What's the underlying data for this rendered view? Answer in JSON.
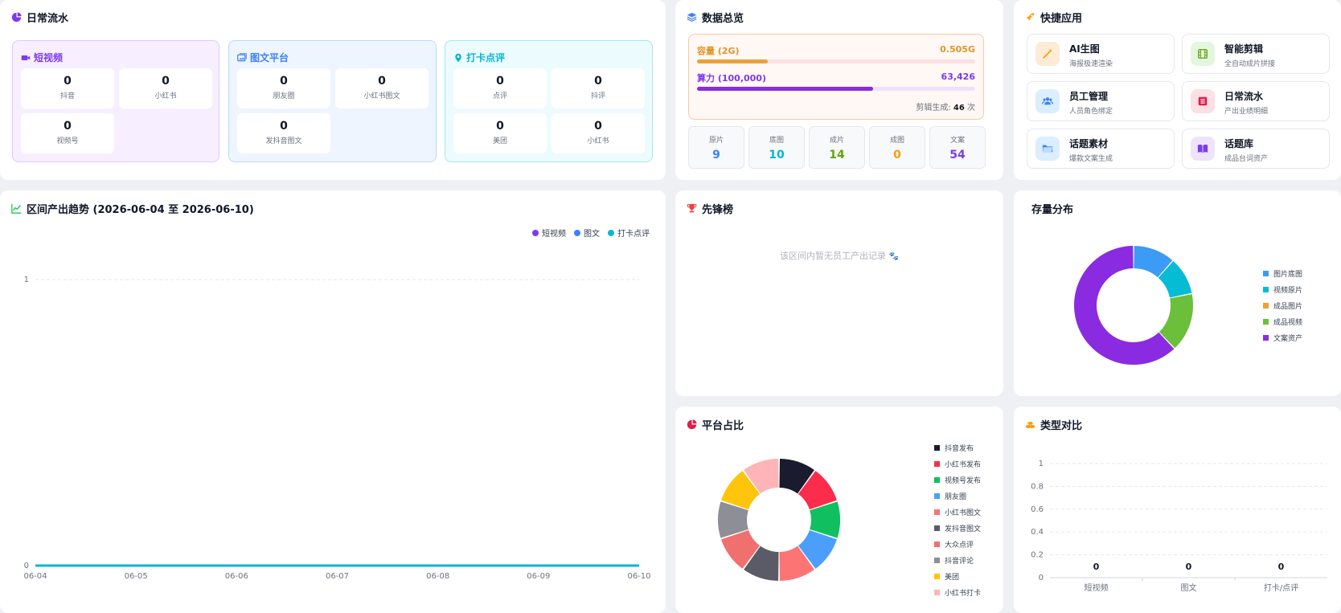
{
  "daily": {
    "title": "日常流水",
    "groups": [
      {
        "title": "短视频",
        "color": "#7c3aed",
        "items": [
          {
            "value": "0",
            "label": "抖音"
          },
          {
            "value": "0",
            "label": "小红书"
          },
          {
            "value": "0",
            "label": "视频号"
          }
        ]
      },
      {
        "title": "图文平台",
        "color": "#3b82f6",
        "items": [
          {
            "value": "0",
            "label": "朋友圈"
          },
          {
            "value": "0",
            "label": "小红书图文"
          },
          {
            "value": "0",
            "label": "发抖音图文"
          }
        ]
      },
      {
        "title": "打卡点评",
        "color": "#06b6d4",
        "items": [
          {
            "value": "0",
            "label": "点评"
          },
          {
            "value": "0",
            "label": "抖评"
          },
          {
            "value": "0",
            "label": "美团"
          },
          {
            "value": "0",
            "label": "小红书"
          }
        ]
      }
    ]
  },
  "overview": {
    "title": "数据总览",
    "capacity": {
      "label": "容量 (2G)",
      "value": "0.505G",
      "progress": 0.253
    },
    "compute": {
      "label": "算力 (100,000)",
      "value": "63,426",
      "progress": 0.634
    },
    "gen_prefix": "剪辑生成:",
    "gen_count": "46",
    "gen_suffix": "次",
    "stats": [
      {
        "label": "原片",
        "value": "9",
        "color": "#3b82f6"
      },
      {
        "label": "底图",
        "value": "10",
        "color": "#06b6d4"
      },
      {
        "label": "成片",
        "value": "14",
        "color": "#65a30d"
      },
      {
        "label": "成图",
        "value": "0",
        "color": "#f59e0b"
      },
      {
        "label": "文案",
        "value": "54",
        "color": "#7c3aed"
      }
    ]
  },
  "quick": {
    "title": "快捷应用",
    "apps": [
      {
        "title": "AI生图",
        "sub": "海报极速渲染",
        "icon": "magic-wand-icon",
        "bg": "#fdebd6",
        "fg": "#f59e0b"
      },
      {
        "title": "智能剪辑",
        "sub": "全自动成片拼接",
        "icon": "film-icon",
        "bg": "#e3f6df",
        "fg": "#65a30d"
      },
      {
        "title": "员工管理",
        "sub": "人员角色绑定",
        "icon": "users-icon",
        "bg": "#dbeefe",
        "fg": "#3b82f6"
      },
      {
        "title": "日常流水",
        "sub": "产出业绩明细",
        "icon": "list-icon",
        "bg": "#fde0e6",
        "fg": "#e11d48"
      },
      {
        "title": "话题素材",
        "sub": "爆款文案生成",
        "icon": "folder-icon",
        "bg": "#dbeefe",
        "fg": "#3b82f6"
      },
      {
        "title": "话题库",
        "sub": "成品台词资产",
        "icon": "book-icon",
        "bg": "#ede4fb",
        "fg": "#7c3aed"
      }
    ]
  },
  "trend": {
    "title": "区间产出趋势 (2026-06-04 至 2026-06-10)",
    "legend": [
      {
        "name": "短视频",
        "color": "#7c3aed"
      },
      {
        "name": "图文",
        "color": "#3b82f6"
      },
      {
        "name": "打卡点评",
        "color": "#06b6d4"
      }
    ]
  },
  "leader": {
    "title": "先锋榜",
    "empty": "该区间内暂无员工产出记录",
    "empty_icon": "paw-icon"
  },
  "storage": {
    "title": "存量分布"
  },
  "platform": {
    "title": "平台占比"
  },
  "typecmp": {
    "title": "类型对比"
  },
  "chart_data": [
    {
      "type": "line",
      "title": "区间产出趋势 (2026-06-04 至 2026-06-10)",
      "x": [
        "06-04",
        "06-05",
        "06-06",
        "06-07",
        "06-08",
        "06-09",
        "06-10"
      ],
      "series": [
        {
          "name": "短视频",
          "color": "#7c3aed",
          "values": [
            0,
            0,
            0,
            0,
            0,
            0,
            0
          ]
        },
        {
          "name": "图文",
          "color": "#3b82f6",
          "values": [
            0,
            0,
            0,
            0,
            0,
            0,
            0
          ]
        },
        {
          "name": "打卡点评",
          "color": "#06b6d4",
          "values": [
            0,
            0,
            0,
            0,
            0,
            0,
            0
          ]
        }
      ],
      "yticks": [
        "0",
        "1"
      ],
      "ylim": [
        0,
        1
      ],
      "legend": "top-right"
    },
    {
      "type": "pie",
      "title": "存量分布",
      "labels": [
        "图片底图",
        "视频原片",
        "成品图片",
        "成品视频",
        "文案资产"
      ],
      "values": [
        10,
        9,
        0,
        14,
        54
      ],
      "colors": [
        "#3b9bf5",
        "#06bcd4",
        "#f0a030",
        "#6bbf3a",
        "#8a2be2"
      ],
      "legend": "right"
    },
    {
      "type": "pie",
      "title": "平台占比",
      "labels": [
        "抖音发布",
        "小红书发布",
        "视频号发布",
        "朋友圈",
        "小红书图文",
        "发抖音图文",
        "大众点评",
        "抖音评论",
        "美团",
        "小红书打卡"
      ],
      "values": [
        1,
        1,
        1,
        1,
        1,
        1,
        1,
        1,
        1,
        1
      ],
      "colors": [
        "#1a1b2e",
        "#fb2c4c",
        "#10c060",
        "#4b9ffa",
        "#fc7474",
        "#5b5b67",
        "#f07070",
        "#8e8e96",
        "#ffc40c",
        "#ffb4b8"
      ],
      "legend": "right"
    },
    {
      "type": "bar",
      "title": "类型对比",
      "categories": [
        "短视频",
        "图文",
        "打卡/点评"
      ],
      "values": [
        0,
        0,
        0
      ],
      "data_labels": [
        "0",
        "0",
        "0"
      ],
      "yticks": [
        "0",
        "0.2",
        "0.4",
        "0.6",
        "0.8",
        "1"
      ],
      "ylim": [
        0,
        1
      ]
    }
  ]
}
